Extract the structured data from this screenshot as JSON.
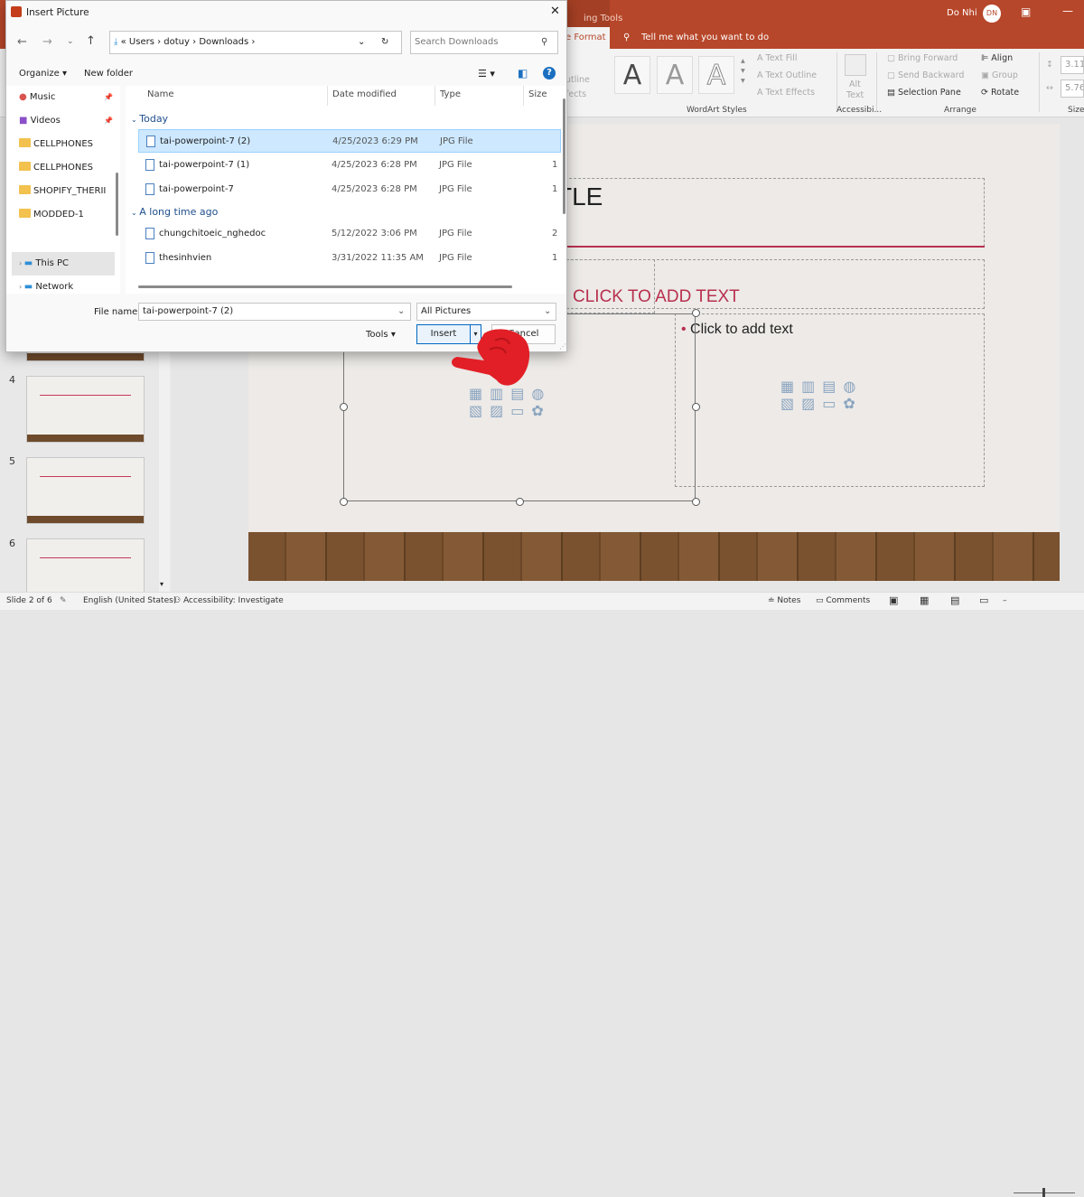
{
  "ppt": {
    "tabs": {
      "picture_tools": "ing Tools",
      "format": "e Format",
      "tell_me": "Tell me what you want to do"
    },
    "user": {
      "name": "Do Nhi",
      "initials": "DN"
    },
    "ribbon": {
      "text_fill": "Text Fill",
      "text_outline": "Text Outline",
      "text_effects": "Text Effects",
      "outline_cut": "utline",
      "effects_cut": "fects",
      "wordart_label": "WordArt Styles",
      "alt_text_1": "Alt",
      "alt_text_2": "Text",
      "accessibility_label": "Accessibi...",
      "bring_forward": "Bring Forward",
      "send_backward": "Send Backward",
      "selection_pane": "Selection Pane",
      "align": "Align",
      "group": "Group",
      "rotate": "Rotate",
      "arrange_label": "Arrange",
      "height": "3.11\"",
      "width": "5.76\"",
      "size_label": "Size"
    },
    "thumbs": [
      "4",
      "5",
      "6"
    ],
    "slide": {
      "title_partial": "TLE",
      "heading": "CLICK TO ADD TEXT",
      "bullet": "Click to add text"
    },
    "status": {
      "slide": "Slide 2 of 6",
      "language": "English (United States)",
      "accessibility": "Accessibility: Investigate",
      "notes": "Notes",
      "comments": "Comments"
    }
  },
  "dialog": {
    "title": "Insert Picture",
    "breadcrumb": [
      "«",
      "Users",
      "dotuy",
      "Downloads"
    ],
    "search_placeholder": "Search Downloads",
    "organize": "Organize",
    "new_folder": "New folder",
    "nav": [
      {
        "label": "Music",
        "icon": "music-icon"
      },
      {
        "label": "Videos",
        "icon": "videos-icon"
      },
      {
        "label": "CELLPHONES",
        "icon": "folder-icon"
      },
      {
        "label": "CELLPHONES",
        "icon": "folder-icon"
      },
      {
        "label": "SHOPIFY_THERII",
        "icon": "folder-icon"
      },
      {
        "label": "MODDED-1",
        "icon": "folder-icon"
      },
      {
        "label": "This PC",
        "icon": "pc-icon"
      },
      {
        "label": "Network",
        "icon": "network-icon"
      }
    ],
    "columns": {
      "name": "Name",
      "date": "Date modified",
      "type": "Type",
      "size": "Size"
    },
    "groups": {
      "today": "Today",
      "long_ago": "A long time ago"
    },
    "files": [
      {
        "name": "tai-powerpoint-7 (2)",
        "date": "4/25/2023 6:29 PM",
        "type": "JPG File",
        "size": ""
      },
      {
        "name": "tai-powerpoint-7 (1)",
        "date": "4/25/2023 6:28 PM",
        "type": "JPG File",
        "size": "1"
      },
      {
        "name": "tai-powerpoint-7",
        "date": "4/25/2023 6:28 PM",
        "type": "JPG File",
        "size": "1"
      },
      {
        "name": "chungchitoeic_nghedoc",
        "date": "5/12/2022 3:06 PM",
        "type": "JPG File",
        "size": "2"
      },
      {
        "name": "thesinhvien",
        "date": "3/31/2022 11:35 AM",
        "type": "JPG File",
        "size": "1"
      }
    ],
    "file_name_label": "File name:",
    "file_name_value": "tai-powerpoint-7 (2)",
    "filter": "All Pictures",
    "tools": "Tools",
    "insert": "Insert",
    "cancel": "Cancel"
  }
}
